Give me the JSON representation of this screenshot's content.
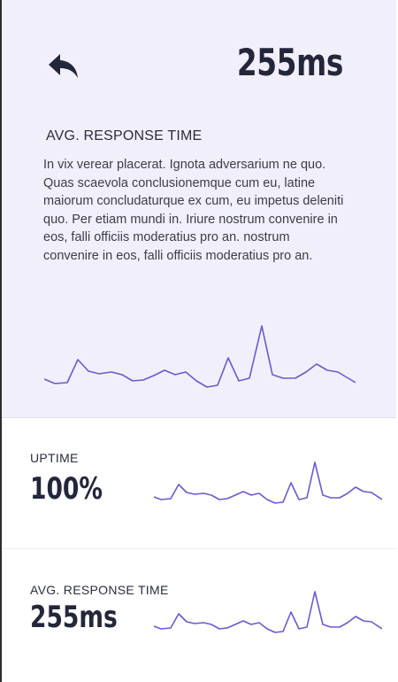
{
  "hero": {
    "value": "255ms",
    "label": "AVG. RESPONSE TIME",
    "description": "In vix verear placerat. Ignota adversarium ne quo. Quas scaevola conclusionemque cum eu, latine maiorum concludaturque ex cum, eu impetus deleniti quo. Per etiam mundi in. Iriure nostrum convenire in eos, falli officiis moderatius pro an. nostrum convenire in eos, falli officiis moderatius pro an.",
    "icon": "back-arrow-icon"
  },
  "cards": [
    {
      "label": "UPTIME",
      "value": "100%"
    },
    {
      "label": "AVG. RESPONSE TIME",
      "value": "255ms"
    }
  ],
  "colors": {
    "hero_background": "#f2effc",
    "sparkline": "#6a5acd",
    "text": "#24263a"
  }
}
